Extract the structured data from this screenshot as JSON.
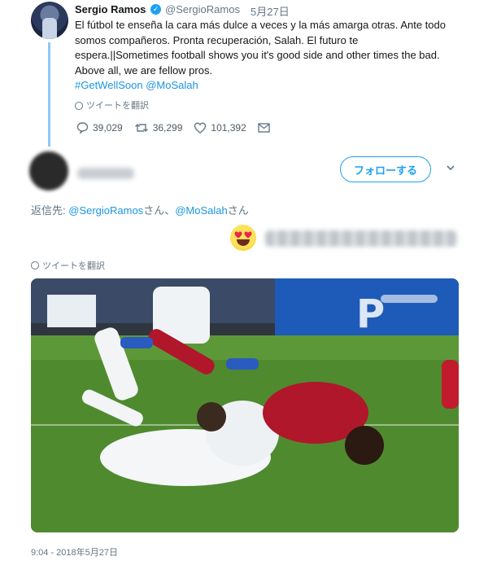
{
  "tweet": {
    "author_name": "Sergio Ramos",
    "handle": "@SergioRamos",
    "date": "5月27日",
    "text_lines": [
      "El fútbol te enseña la cara más dulce a veces y la más amarga otras. Ante todo",
      "somos compañeros. Pronta recuperación, Salah. El futuro te",
      "espera.||Sometimes football shows you it's good side and other times the bad.",
      "Above all, we are fellow pros."
    ],
    "hashtag": "#GetWellSoon",
    "mention": "@MoSalah",
    "translate_label": "ツイートを翻訳",
    "replies": "39,029",
    "retweets": "36,299",
    "likes": "101,392"
  },
  "reply": {
    "follow_label": "フォローする",
    "replying_prefix": "返信先: ",
    "mention1": "@SergioRamos",
    "san1": "さん、",
    "mention2": "@MoSalah",
    "san2": "さん",
    "translate_label": "ツイートを翻訳",
    "timestamp": "9:04 - 2018年5月27日"
  },
  "colors": {
    "accent": "#1da1f2",
    "link": "#1b95e0",
    "muted": "#657786",
    "thread": "#8fc7f3"
  }
}
